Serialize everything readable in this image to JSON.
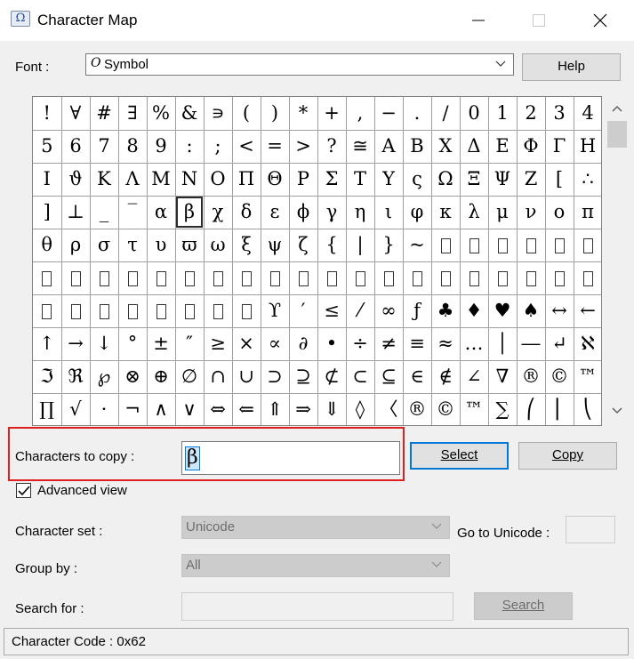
{
  "window": {
    "title": "Character Map",
    "app_icon": "charmap-icon",
    "minimize_icon": "minimize-icon",
    "maximize_icon": "maximize-icon",
    "close_icon": "close-icon"
  },
  "font": {
    "label": "Font :",
    "value": "Symbol",
    "font_type_glyph": "O",
    "help_label": "Help"
  },
  "character_grid": {
    "rows": [
      [
        "!",
        "∀",
        "#",
        "∃",
        "%",
        "&",
        "∍",
        "(",
        ")",
        "*",
        "+",
        ",",
        "−",
        ".",
        "/",
        "0",
        "1",
        "2",
        "3",
        "4"
      ],
      [
        "5",
        "6",
        "7",
        "8",
        "9",
        ":",
        ";",
        "<",
        "=",
        ">",
        "?",
        "≅",
        "Α",
        "Β",
        "Χ",
        "Δ",
        "Ε",
        "Φ",
        "Γ",
        "Η"
      ],
      [
        "Ι",
        "ϑ",
        "Κ",
        "Λ",
        "Μ",
        "Ν",
        "Ο",
        "Π",
        "Θ",
        "Ρ",
        "Σ",
        "Τ",
        "Υ",
        "ς",
        "Ω",
        "Ξ",
        "Ψ",
        "Ζ",
        "[",
        "∴"
      ],
      [
        "]",
        "⊥",
        "_",
        "‾",
        "α",
        "β",
        "χ",
        "δ",
        "ε",
        "ϕ",
        "γ",
        "η",
        "ι",
        "φ",
        "κ",
        "λ",
        "μ",
        "ν",
        "ο",
        "π"
      ],
      [
        "θ",
        "ρ",
        "σ",
        "τ",
        "υ",
        "ϖ",
        "ω",
        "ξ",
        "ψ",
        "ζ",
        "{",
        "|",
        "}",
        "~",
        "□",
        "□",
        "□",
        "□",
        "□",
        "□"
      ],
      [
        "□",
        "□",
        "□",
        "□",
        "□",
        "□",
        "□",
        "□",
        "□",
        "□",
        "□",
        "□",
        "□",
        "□",
        "□",
        "□",
        "□",
        "□",
        "□",
        "□"
      ],
      [
        "□",
        "□",
        "□",
        "□",
        "□",
        "□",
        "□",
        "□",
        "ϒ",
        "′",
        "≤",
        "⁄",
        "∞",
        "ƒ",
        "♣",
        "♦",
        "♥",
        "♠",
        "↔",
        "←"
      ],
      [
        "↑",
        "→",
        "↓",
        "°",
        "±",
        "″",
        "≥",
        "×",
        "∝",
        "∂",
        "•",
        "÷",
        "≠",
        "≡",
        "≈",
        "…",
        "│",
        "―",
        "↵",
        "ℵ"
      ],
      [
        "ℑ",
        "ℜ",
        "℘",
        "⊗",
        "⊕",
        "∅",
        "∩",
        "∪",
        "⊃",
        "⊇",
        "⊄",
        "⊂",
        "⊆",
        "∈",
        "∉",
        "∠",
        "∇",
        "®",
        "©",
        "™"
      ],
      [
        "∏",
        "√",
        "⋅",
        "¬",
        "∧",
        "∨",
        "⇔",
        "⇐",
        "⇑",
        "⇒",
        "⇓",
        "◊",
        "〈",
        "®",
        "©",
        "™",
        "∑",
        "⎛",
        "⎜",
        "⎝"
      ]
    ],
    "selected_row": 3,
    "selected_col": 5
  },
  "copy": {
    "label": "Characters to copy :",
    "value": "β",
    "select_label": "Select",
    "copy_label": "Copy"
  },
  "advanced": {
    "label": "Advanced view",
    "checked": true
  },
  "character_set": {
    "label": "Character set :",
    "value": "Unicode"
  },
  "goto_unicode": {
    "label": "Go to Unicode :",
    "value": ""
  },
  "group_by": {
    "label": "Group by :",
    "value": "All"
  },
  "search": {
    "label": "Search for :",
    "value": "",
    "button_label": "Search"
  },
  "status": {
    "text": "Character Code : 0x62"
  }
}
